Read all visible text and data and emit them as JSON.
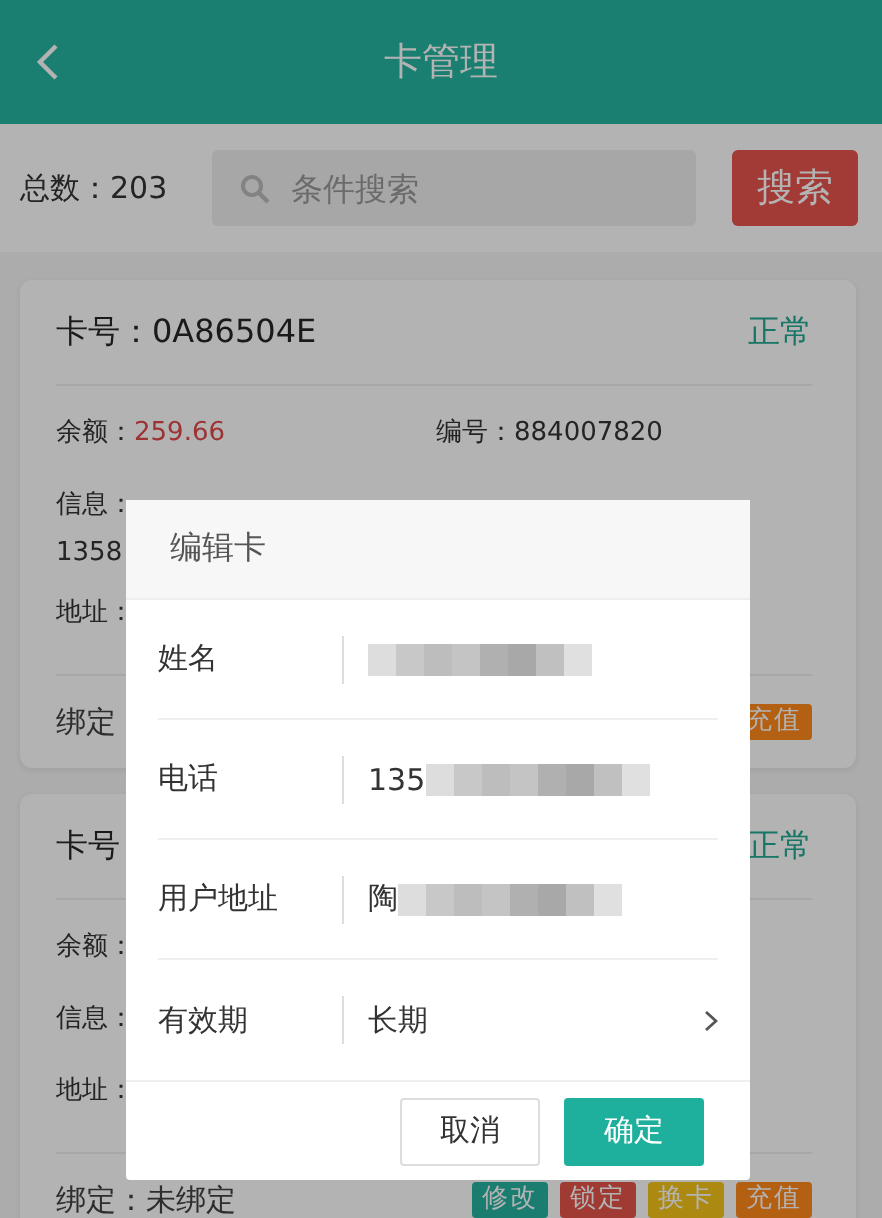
{
  "header": {
    "title": "卡管理"
  },
  "toolbar": {
    "total": "总数：203",
    "search": {
      "placeholder": "条件搜索"
    },
    "search_button": "搜索"
  },
  "cards": [
    {
      "card_label": "卡号：0A86504E",
      "status": "正常",
      "rows": [
        {
          "cells": [
            {
              "label": "余额：",
              "value": "259.66",
              "kind": "amount"
            },
            {
              "label": "编号：",
              "value": "884007820",
              "kind": "plain"
            }
          ]
        },
        {
          "cells": [
            {
              "label": "信息：",
              "value": "1358",
              "kind": "multiline"
            }
          ]
        },
        {
          "cells": [
            {
              "label": "地址："
            }
          ]
        }
      ],
      "binding": "绑定",
      "actions": [
        {
          "label": "充值",
          "color": "#b36013"
        }
      ]
    },
    {
      "card_label": "卡号",
      "status": "正常",
      "rows": [
        {
          "cells": [
            {
              "label": "余额："
            }
          ]
        },
        {
          "cells": [
            {
              "label": "信息："
            }
          ]
        },
        {
          "cells": [
            {
              "label": "地址："
            }
          ]
        }
      ],
      "binding": "绑定：未绑定",
      "actions": [
        {
          "label": "修改",
          "color": "#1b7c70"
        },
        {
          "label": "锁定",
          "color": "#a03b34"
        },
        {
          "label": "换卡",
          "color": "#ac8a11"
        },
        {
          "label": "充值",
          "color": "#b36013"
        }
      ]
    }
  ],
  "dialog": {
    "title": "编辑卡",
    "fields": [
      {
        "label": "姓名",
        "kind": "redacted"
      },
      {
        "label": "电话",
        "value": "135",
        "kind": "redacted"
      },
      {
        "label": "用户地址",
        "value": "陶",
        "kind": "redacted"
      },
      {
        "label": "有效期",
        "value": "长期",
        "kind": "select"
      }
    ],
    "buttons": [
      {
        "label": "取消",
        "kind": "secondary"
      },
      {
        "label": "确定",
        "kind": "primary"
      }
    ]
  }
}
